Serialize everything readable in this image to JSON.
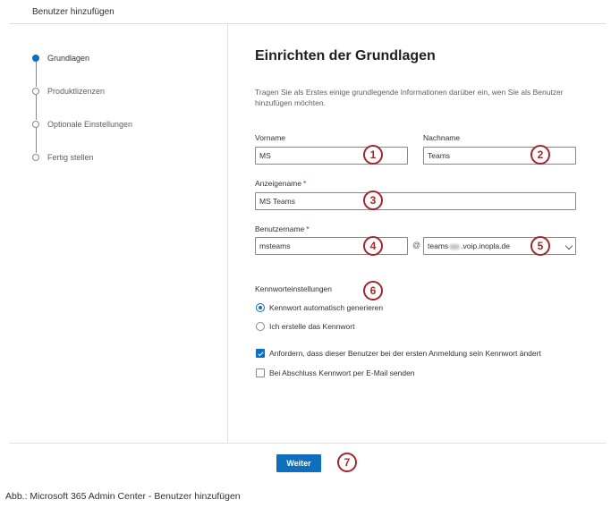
{
  "panel": {
    "title": "Benutzer hinzufügen"
  },
  "steps": [
    {
      "label": "Grundlagen",
      "active": true
    },
    {
      "label": "Produktlizenzen",
      "active": false
    },
    {
      "label": "Optionale Einstellungen",
      "active": false
    },
    {
      "label": "Fertig stellen",
      "active": false
    }
  ],
  "main": {
    "heading": "Einrichten der Grundlagen",
    "intro": "Tragen Sie als Erstes einige grundlegende Informationen darüber ein, wen Sie als Benutzer hinzufügen möchten."
  },
  "form": {
    "firstname": {
      "label": "Vorname",
      "value": "MS"
    },
    "lastname": {
      "label": "Nachname",
      "value": "Teams"
    },
    "displayname": {
      "label": "Anzeigename",
      "required_mark": "*",
      "value": "MS Teams"
    },
    "username": {
      "label": "Benutzername",
      "required_mark": "*",
      "value": "msteams"
    },
    "at_sign": "@",
    "domain": {
      "prefix": "teams",
      "suffix": ".voip.inopla.de"
    },
    "password_settings": {
      "label": "Kennworteinstellungen",
      "radio_auto": {
        "label": "Kennwort automatisch generieren",
        "checked": true
      },
      "radio_manual": {
        "label": "Ich erstelle das Kennwort",
        "checked": false
      }
    },
    "checkbox_change": {
      "label": "Anfordern, dass dieser Benutzer bei der ersten Anmeldung sein Kennwort ändert",
      "checked": true
    },
    "checkbox_email": {
      "label": "Bei Abschluss Kennwort per E-Mail senden",
      "checked": false
    }
  },
  "footer": {
    "next_label": "Weiter"
  },
  "badges": [
    "1",
    "2",
    "3",
    "4",
    "5",
    "6",
    "7"
  ],
  "caption": "Abb.: Microsoft 365 Admin Center - Benutzer hinzufügen",
  "colors": {
    "accent": "#106ebe",
    "badge": "#a4262c",
    "required": "#a4262c",
    "border": "#8a8886"
  }
}
